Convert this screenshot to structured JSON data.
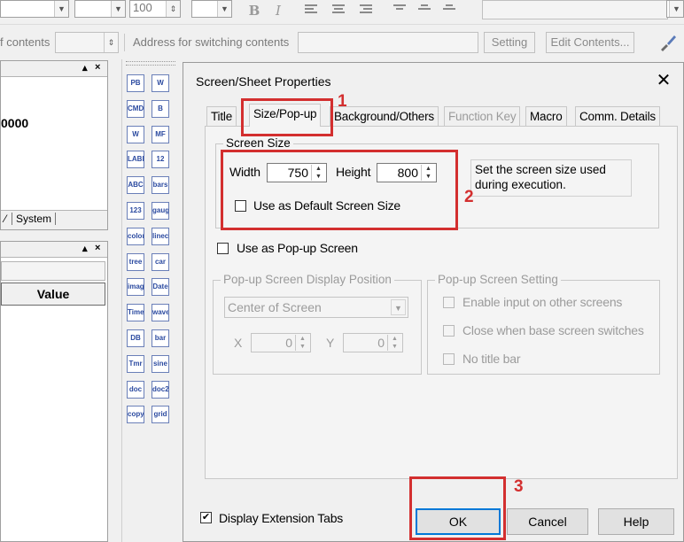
{
  "toolbar": {
    "font_size_value": "100",
    "bold_label": "B",
    "italic_label": "I",
    "contents_label": "f contents",
    "address_label": "Address for switching contents",
    "setting_button": "Setting",
    "edit_contents_button": "Edit Contents..."
  },
  "left_panel_top": {
    "value_text": "0000",
    "tab_system": "System",
    "minimize": "▴",
    "close": "×"
  },
  "left_panel_bottom": {
    "column_header": "Value",
    "minimize": "▴",
    "close": "×"
  },
  "palette": {
    "icons": [
      "PB",
      "W",
      "CMD",
      "B",
      "W",
      "MF",
      "LABEL",
      "12",
      "ABC",
      "bars",
      "123",
      "gauge",
      "colorbar",
      "linechart",
      "tree",
      "car",
      "image",
      "Date",
      "Time",
      "wave",
      "DB",
      "bar",
      "Tmr",
      "sine",
      "doc",
      "doc2",
      "copy",
      "grid"
    ]
  },
  "dialog": {
    "title": "Screen/Sheet Properties",
    "close_symbol": "✕",
    "tabs": [
      {
        "label": "Title",
        "state": "normal"
      },
      {
        "label": "Size/Pop-up",
        "state": "active"
      },
      {
        "label": "Background/Others",
        "state": "normal"
      },
      {
        "label": "Function Key",
        "state": "disabled"
      },
      {
        "label": "Macro",
        "state": "normal"
      },
      {
        "label": "Comm. Details",
        "state": "normal"
      }
    ],
    "screen_size": {
      "group_label": "Screen Size",
      "width_label": "Width",
      "width_value": "750",
      "height_label": "Height",
      "height_value": "800",
      "info_text": "Set the screen size used during execution.",
      "default_size_label": "Use as Default Screen Size",
      "default_size_checked": false
    },
    "popup_screen": {
      "label": "Use as Pop-up Screen",
      "checked": false
    },
    "popup_position": {
      "group_label": "Pop-up Screen Display Position",
      "select_value": "Center of Screen",
      "x_label": "X",
      "x_value": "0",
      "y_label": "Y",
      "y_value": "0"
    },
    "popup_setting": {
      "group_label": "Pop-up Screen Setting",
      "options": [
        {
          "label": "Enable input on other screens",
          "checked": false
        },
        {
          "label": "Close when base screen switches",
          "checked": false
        },
        {
          "label": "No title bar",
          "checked": false
        }
      ]
    },
    "extension_tabs": {
      "label": "Display Extension Tabs",
      "checked": true,
      "check_mark": "✔"
    },
    "buttons": {
      "ok": "OK",
      "cancel": "Cancel",
      "help": "Help"
    }
  },
  "annotations": {
    "step1": "1",
    "step2": "2",
    "step3": "3",
    "color": "#d32f2f"
  }
}
